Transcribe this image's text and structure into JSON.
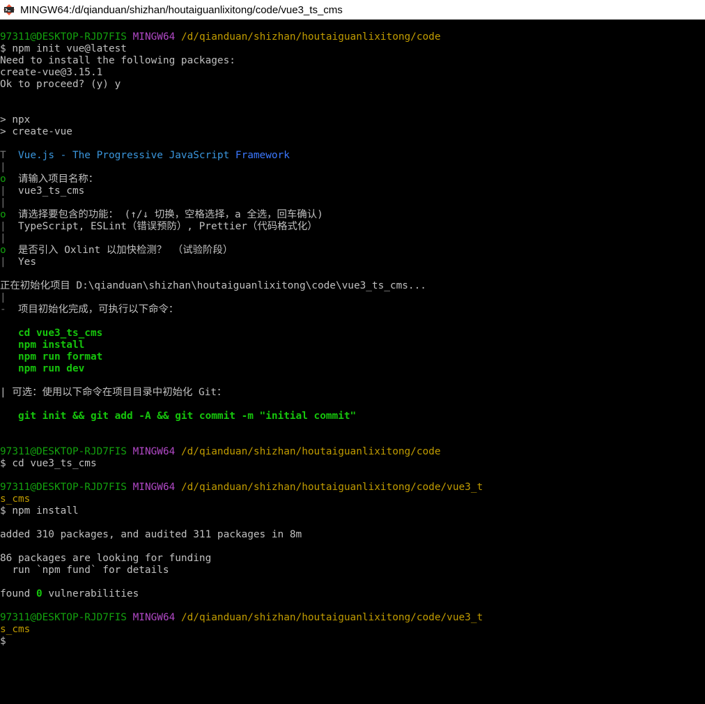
{
  "window": {
    "title": "MINGW64:/d/qianduan/shizhan/houtaiguanlixitong/code/vue3_ts_cms",
    "icon": "git-bash-icon"
  },
  "prompt1": {
    "user": "97311@DESKTOP-RJD7FIS",
    "env": "MINGW64",
    "path": "/d/qianduan/shizhan/houtaiguanlixitong/code"
  },
  "cmd1": "$ npm init vue@latest",
  "npx": {
    "l1": "Need to install the following packages:",
    "l2": "create-vue@3.15.1",
    "l3": "Ok to proceed? (y) y",
    "l4": "> npx",
    "l5": "> create-vue"
  },
  "vue": {
    "bar_t": "T",
    "title_a": "Vue.js - The Progressive JavaScript ",
    "title_b": "Framework",
    "pipe": "|",
    "bullet": "o",
    "q1": "请输入项目名称：",
    "a1": "vue3_ts_cms",
    "q2": "请选择要包含的功能： (↑/↓ 切换，空格选择，a 全选，回车确认)",
    "a2": "TypeScript, ESLint（错误预防）, Prettier（代码格式化）",
    "q3": "是否引入 Oxlint 以加快检测？ （试验阶段）",
    "a3": "Yes",
    "init": "正在初始化项目 D:\\qianduan\\shizhan\\houtaiguanlixitong\\code\\vue3_ts_cms...",
    "done_dash": "-",
    "done": "项目初始化完成，可执行以下命令：",
    "cmds": [
      "cd vue3_ts_cms",
      "npm install",
      "npm run format",
      "npm run dev"
    ],
    "optional": "| 可选：使用以下命令在项目目录中初始化 Git：",
    "git_cmd": "git init && git add -A && git commit -m \"initial commit\""
  },
  "prompt2": {
    "user": "97311@DESKTOP-RJD7FIS",
    "env": "MINGW64",
    "path": "/d/qianduan/shizhan/houtaiguanlixitong/code"
  },
  "cmd2": "$ cd vue3_ts_cms",
  "prompt3": {
    "user": "97311@DESKTOP-RJD7FIS",
    "env": "MINGW64",
    "path": "/d/qianduan/shizhan/houtaiguanlixitong/code/vue3_t",
    "path_wrap": "s_cms"
  },
  "cmd3": "$ npm install",
  "install": {
    "l1": "added 310 packages, and audited 311 packages in 8m",
    "l2": "86 packages are looking for funding",
    "l3": "  run `npm fund` for details",
    "l4a": "found ",
    "l4b": "0",
    "l4c": " vulnerabilities"
  },
  "prompt4": {
    "user": "97311@DESKTOP-RJD7FIS",
    "env": "MINGW64",
    "path": "/d/qianduan/shizhan/houtaiguanlixitong/code/vue3_t",
    "path_wrap": "s_cms"
  },
  "cmd4": "$",
  "colors": {
    "background": "#000000",
    "text": "#c0c0c0",
    "user": "#13a10e",
    "env": "#b148c6",
    "path": "#c19c00",
    "highlight": "#16c60c",
    "framework": "#3b78ff"
  }
}
